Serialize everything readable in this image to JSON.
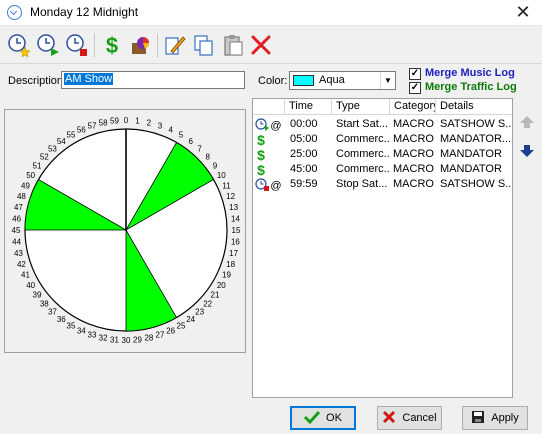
{
  "window": {
    "title": "Monday 12 Midnight",
    "close_glyph": "✕"
  },
  "toolbar": {
    "buttons": [
      {
        "name": "clock-star-icon"
      },
      {
        "name": "clock-play-icon"
      },
      {
        "name": "clock-stop-icon"
      },
      {
        "name": "dollar-icon"
      },
      {
        "name": "pie-icon"
      },
      {
        "name": "edit-icon"
      },
      {
        "name": "copy-icon"
      },
      {
        "name": "paste-icon"
      },
      {
        "name": "delete-icon"
      }
    ]
  },
  "form": {
    "description_label": "Description:",
    "description_value": "AM Show",
    "color_label": "Color:",
    "color_value": "Aqua",
    "color_hex": "#00ffff",
    "merge_music_label": "Merge Music Log",
    "merge_music_checked": true,
    "merge_music_color": "#1f1fbf",
    "merge_traffic_label": "Merge Traffic Log",
    "merge_traffic_checked": true,
    "merge_traffic_color": "#0c7a0c"
  },
  "clock": {
    "minute_labels": [
      "0",
      "1",
      "2",
      "3",
      "4",
      "5",
      "6",
      "7",
      "8",
      "9",
      "10",
      "11",
      "12",
      "13",
      "14",
      "15",
      "16",
      "17",
      "18",
      "19",
      "20",
      "21",
      "22",
      "23",
      "24",
      "25",
      "26",
      "27",
      "28",
      "29",
      "30",
      "31",
      "32",
      "33",
      "34",
      "35",
      "36",
      "37",
      "38",
      "39",
      "40",
      "41",
      "42",
      "43",
      "44",
      "45",
      "46",
      "47",
      "48",
      "49",
      "50",
      "51",
      "52",
      "53",
      "54",
      "55",
      "56",
      "57",
      "58",
      "59"
    ],
    "commercial_segments": [
      {
        "start_min": 5,
        "end_min": 10
      },
      {
        "start_min": 25,
        "end_min": 30
      },
      {
        "start_min": 45,
        "end_min": 50
      }
    ],
    "wedge_color": "#00ff00"
  },
  "grid": {
    "columns": [
      "Time",
      "Type",
      "Category",
      "Details"
    ],
    "rows": [
      {
        "icon": "clock-start-icon",
        "time": "00:00",
        "type": "Start Sat...",
        "category": "MACRO",
        "details": "SATSHOW S..."
      },
      {
        "icon": "dollar-icon",
        "time": "05:00",
        "type": "Commerc...",
        "category": "MACRO",
        "details": "MANDATOR..."
      },
      {
        "icon": "dollar-icon",
        "time": "25:00",
        "type": "Commerc...",
        "category": "MACRO",
        "details": "MANDATOR"
      },
      {
        "icon": "dollar-icon",
        "time": "45:00",
        "type": "Commerc...",
        "category": "MACRO",
        "details": "MANDATOR"
      },
      {
        "icon": "clock-stop-icon",
        "time": "59:59",
        "type": "Stop Sat...",
        "category": "MACRO",
        "details": "SATSHOW S..."
      }
    ]
  },
  "buttons": {
    "ok_label": "OK",
    "cancel_label": "Cancel",
    "apply_label": "Apply"
  }
}
